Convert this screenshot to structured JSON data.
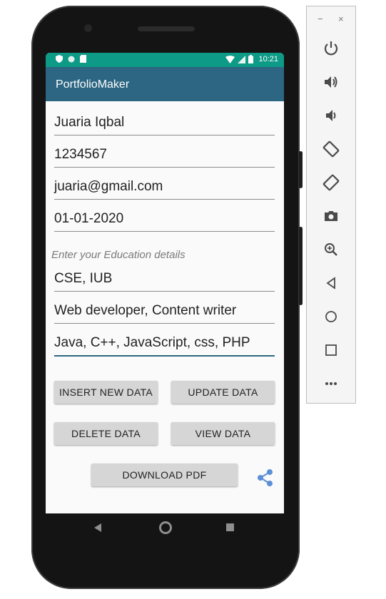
{
  "statusbar": {
    "time": "10:21"
  },
  "app": {
    "title": "PortfolioMaker"
  },
  "form": {
    "name": "Juaria Iqbal",
    "phone": "1234567",
    "email": "juaria@gmail.com",
    "date": "01-01-2020",
    "education_placeholder": "Enter your Education details",
    "education": "CSE, IUB",
    "experience": "Web developer, Content writer",
    "skills": "Java, C++, JavaScript, css, PHP"
  },
  "buttons": {
    "insert": "INSERT NEW DATA",
    "update": "UPDATE DATA",
    "delete": "DELETE DATA",
    "view": "VIEW DATA",
    "download": "DOWNLOAD PDF"
  },
  "colors": {
    "statusbar": "#0d9a86",
    "appbar": "#2d6682",
    "share": "#5b8fd6"
  },
  "panel": {
    "minimize": "−",
    "close": "×",
    "icons": [
      "power-icon",
      "volume-up-icon",
      "volume-down-icon",
      "rotate-left-icon",
      "rotate-right-icon",
      "camera-icon",
      "zoom-icon",
      "back-icon",
      "home-icon",
      "overview-icon",
      "more-icon"
    ]
  }
}
